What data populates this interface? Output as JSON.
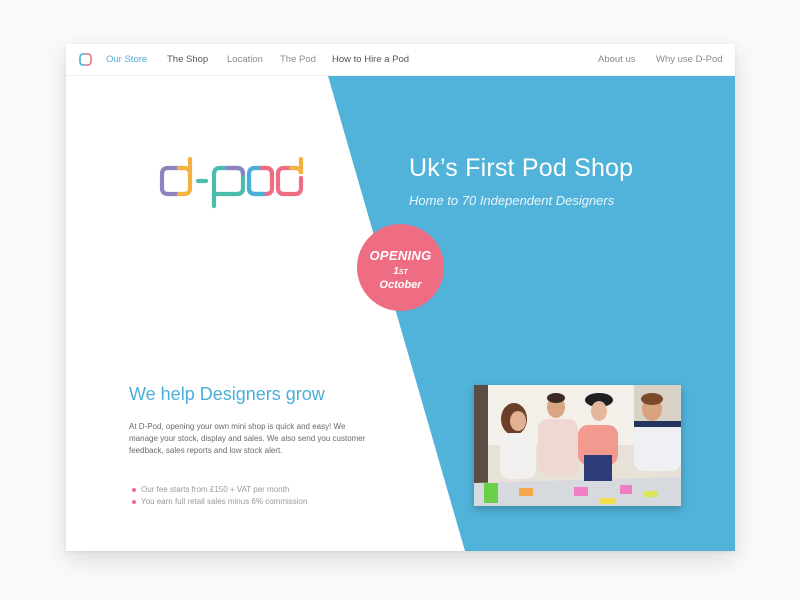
{
  "nav": {
    "left": [
      {
        "label": "Our Store",
        "active": true
      },
      {
        "label": "The Shop"
      },
      {
        "label": "Location"
      },
      {
        "label": "The Pod"
      },
      {
        "label": "How to Hire a Pod"
      }
    ],
    "right": [
      {
        "label": "About us"
      },
      {
        "label": "Why use D-Pod"
      }
    ]
  },
  "brand": {
    "logo_text": "d-pod",
    "colors": {
      "blue": "#4aaed9",
      "pink": "#ee6d82",
      "purple": "#8c83c1",
      "yellow": "#f3b23f",
      "teal": "#4dbcab"
    }
  },
  "hero": {
    "title": "Uk’s First Pod Shop",
    "subtitle": "Home to 70 Independent Designers"
  },
  "badge": {
    "line1": "OPENING",
    "day": "1",
    "day_suffix": "ST",
    "month": "October"
  },
  "about": {
    "title": "We help Designers grow",
    "body": "At D-Pod, opening your own mini shop is quick and easy! We manage your stock, display and sales. We also send you customer feedback, sales reports and low stock alert.",
    "bullets": [
      "Our fee starts from £150 + VAT per month",
      "You earn full retail sales minus 6% commission"
    ]
  },
  "photo": {
    "alt": "Team of designers working around a table with sticky notes"
  }
}
